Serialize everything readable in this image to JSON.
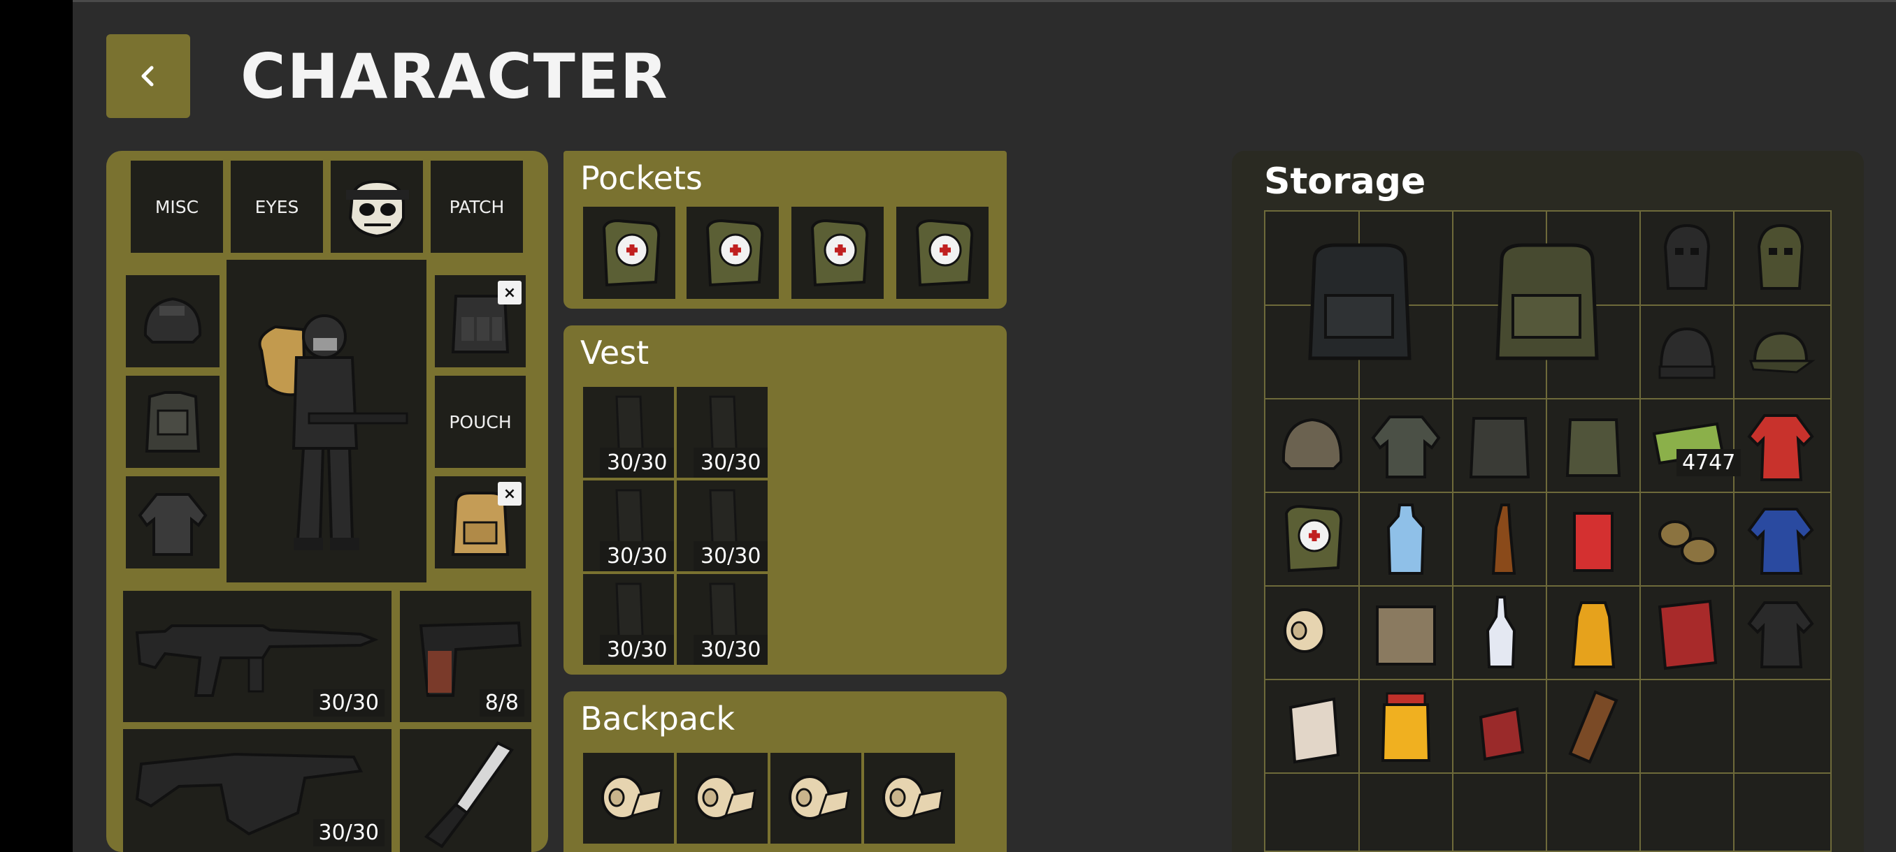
{
  "header": {
    "title": "CHARACTER",
    "back_icon": "chevron-left-icon"
  },
  "character": {
    "top_slots": [
      {
        "label": "MISC"
      },
      {
        "label": "EYES"
      },
      {
        "label": "",
        "icon": "skull-mask-icon"
      },
      {
        "label": "PATCH"
      }
    ],
    "left_slots": [
      "helmet-icon",
      "body-armor-icon",
      "jacket-icon"
    ],
    "right_slots": [
      {
        "icon": "tactical-rig-icon",
        "removable": true
      },
      {
        "label": "POUCH"
      },
      {
        "icon": "backpack-tan-icon",
        "removable": true
      }
    ],
    "remove_glyph": "×",
    "weapons": [
      {
        "icon": "assault-rifle-icon",
        "ammo": "30/30"
      },
      {
        "icon": "pistol-icon",
        "ammo": "8/8"
      },
      {
        "icon": "smg-icon",
        "ammo": "30/30"
      },
      {
        "icon": "knife-icon",
        "ammo": ""
      }
    ]
  },
  "pockets": {
    "title": "Pockets",
    "items": [
      "medkit-icon",
      "medkit-icon",
      "medkit-icon",
      "medkit-icon"
    ]
  },
  "vest": {
    "title": "Vest",
    "mags": [
      "30/30",
      "30/30",
      "30/30",
      "30/30",
      "30/30",
      "30/30"
    ]
  },
  "backpack": {
    "title": "Backpack",
    "items": [
      "bandage-icon",
      "bandage-icon",
      "bandage-icon",
      "bandage-icon"
    ]
  },
  "storage": {
    "title": "Storage",
    "money_count": "4747",
    "items": [
      "backpack-black-icon",
      "backpack-olive-icon",
      "balaclava-black-icon",
      "balaclava-olive-icon",
      "beanie-icon",
      "cap-icon",
      "tactical-helmet-icon",
      "shirt-icon",
      "plate-carrier-icon",
      "chest-rig-icon",
      "money-icon",
      "tracksuit-red-icon",
      "medkit-icon",
      "water-bottle-icon",
      "beer-bottle-icon",
      "soda-can-icon",
      "potatoes-icon",
      "tracksuit-blue-icon",
      "bandage-icon",
      "tin-can-icon",
      "vodka-icon",
      "mustard-icon",
      "chips-icon",
      "tracksuit-black-icon",
      "cigarette-pack-icon",
      "pickles-jar-icon",
      "cigarettes-icon",
      "chocolate-icon"
    ]
  },
  "colors": {
    "accent": "#7a7230",
    "background": "#2c2c2c",
    "slot": "#1f1f1a"
  }
}
